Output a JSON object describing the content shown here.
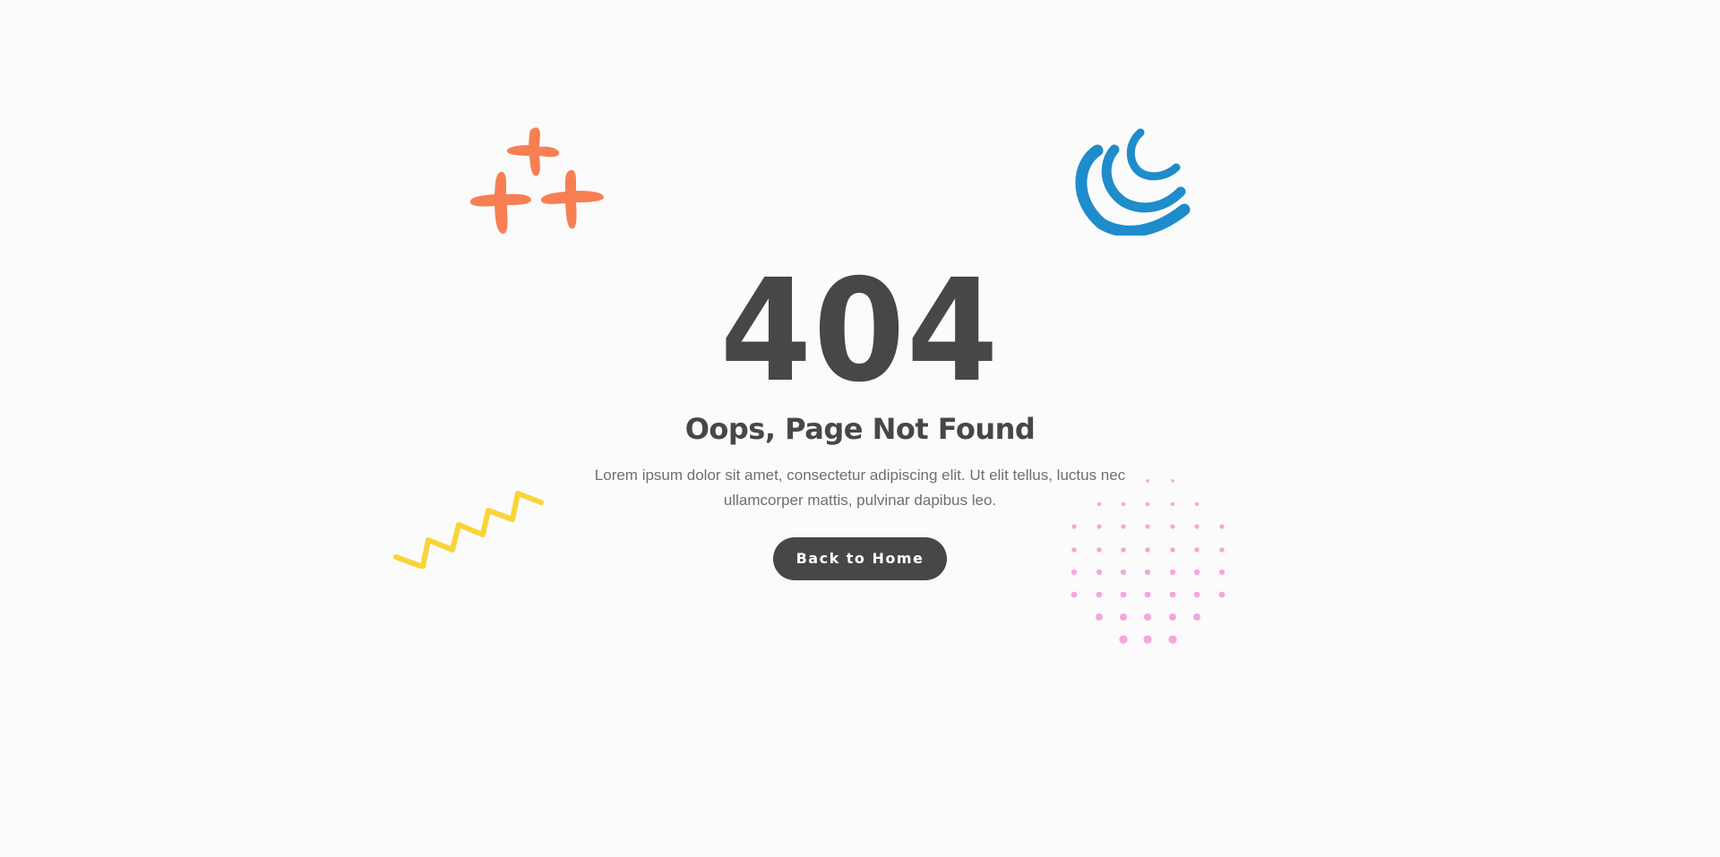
{
  "error": {
    "code": "404",
    "title": "Oops, Page Not Found",
    "description": "Lorem ipsum dolor sit amet, consectetur adipiscing elit. Ut elit tellus, luctus nec ullamcorper mattis, pulvinar dapibus leo."
  },
  "actions": {
    "home_label": "Back to Home"
  },
  "decorations": {
    "plus_cluster": {
      "icon": "plus-cluster-icon",
      "color": "#f77f52"
    },
    "swirl": {
      "icon": "swirl-icon",
      "color": "#1f8ccb"
    },
    "zigzag": {
      "icon": "zigzag-icon",
      "color": "#f8d535"
    },
    "dot_grid": {
      "icon": "dot-grid-icon",
      "color": "#f4a7d8"
    }
  },
  "colors": {
    "background": "#fbfbfb",
    "text_dark": "#474747",
    "text_muted": "#6f6f6f",
    "button_bg": "#474747",
    "button_text": "#ffffff"
  }
}
